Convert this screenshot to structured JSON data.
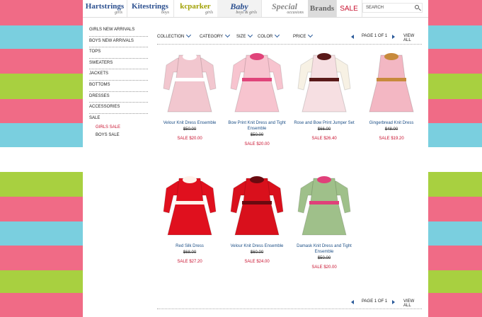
{
  "colors": {
    "stripe_pink": "#f06b86",
    "stripe_blue": "#7acfdf",
    "stripe_green": "#a8d040",
    "sale_red": "#c8102e",
    "link_blue": "#1c4f86"
  },
  "brands": [
    {
      "name": "Hartstrings",
      "sub": "girls",
      "color": "#2b4f8f"
    },
    {
      "name": "Kitestrings",
      "sub": "boys",
      "color": "#2b4f8f"
    },
    {
      "name": "kcparker",
      "sub": "girls",
      "color": "#a0a000"
    },
    {
      "name": "Baby",
      "sub": "boys & girls",
      "color": "#2b4f8f"
    },
    {
      "name": "Special",
      "sub": "occasions",
      "color": "#888888"
    },
    {
      "name": "Brands",
      "sub": "",
      "color": "#666666"
    },
    {
      "name": "SALE",
      "sub": "",
      "color": "#c8102e"
    }
  ],
  "search": {
    "placeholder": "SEARCH"
  },
  "sidebar": {
    "categories": [
      "Girls New Arrivals",
      "Boys New Arrivals",
      "Tops",
      "Sweaters",
      "Jackets",
      "Bottoms",
      "Dresses",
      "Accessories"
    ],
    "sale_label": "Sale",
    "sale_items": [
      "Girls Sale",
      "Boys Sale"
    ]
  },
  "filters": [
    "Collection",
    "Category",
    "Size",
    "Color",
    "Price"
  ],
  "pager": {
    "page_text": "PAGE 1 OF 1",
    "view_all": "VIEW ALL"
  },
  "products": [
    {
      "name": "Velour Knit Dress Ensemble",
      "old": "$50.00",
      "sale": "SALE $20.00",
      "color": "#f2c7cf",
      "trim": "#ffffff"
    },
    {
      "name": "Bow Print Knit Dress and Tight Ensemble",
      "old": "$50.00",
      "sale": "SALE $20.00",
      "color": "#f7c4cf",
      "trim": "#e0447a"
    },
    {
      "name": "Rose and Bow Print Jumper Set",
      "old": "$66.00",
      "sale": "SALE $26.40",
      "color": "#f6dfe2",
      "trim": "#5a1a1a"
    },
    {
      "name": "Gingerbread Knit Dress",
      "old": "$48.00",
      "sale": "SALE $19.20",
      "color": "#f3b7c3",
      "trim": "#c78a3c"
    },
    {
      "name": "Red Silk Dress",
      "old": "$68.00",
      "sale": "SALE $27.20",
      "color": "#e0101e",
      "trim": "#fff2ea"
    },
    {
      "name": "Velour Knit Dress Ensemble",
      "old": "$60.00",
      "sale": "SALE $24.00",
      "color": "#d9101c",
      "trim": "#6a0a10"
    },
    {
      "name": "Damask Knit Dress and Tight Ensemble",
      "old": "$50.00",
      "sale": "SALE $20.00",
      "color": "#9fc08a",
      "trim": "#e0407a"
    }
  ]
}
